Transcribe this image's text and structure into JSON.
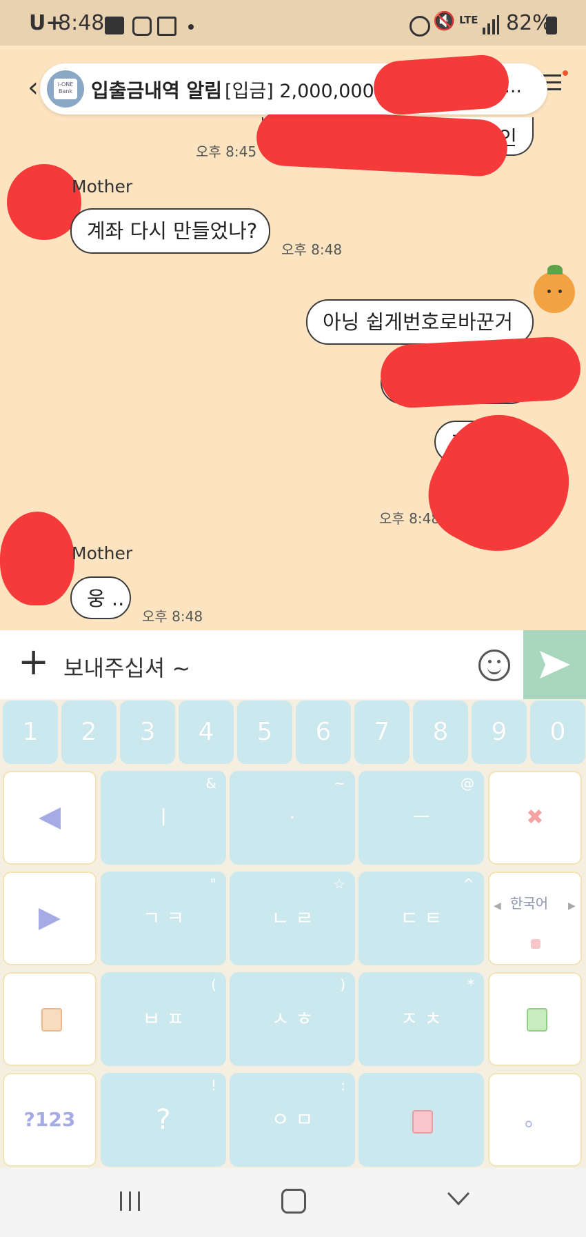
{
  "status_bar": {
    "carrier": "U+",
    "time": "8:48",
    "lte": "LTE",
    "battery": "82%"
  },
  "notification": {
    "bank_logo": "i-ONE Bank",
    "title": "입출금내역 알림",
    "text": "[입금] 2,000,000원",
    "ellipsis": "-*..."
  },
  "chat": {
    "messages": [
      {
        "time": "오후 8:45"
      },
      {
        "sender": "Mother",
        "text": "계좌 다시 만들었나?",
        "time": "오후 8:48"
      },
      {
        "text": "아닝 쉽게번호로바꾼거"
      },
      {
        "text": "기억"
      },
      {
        "time": "오후 8:48"
      },
      {
        "sender": "Mother",
        "text": "웅 ..",
        "time": "오후 8:48"
      }
    ],
    "partial_text": "확인"
  },
  "input": {
    "value": "보내주십셔 ~",
    "plus_label": "+"
  },
  "keyboard": {
    "numbers": [
      "1",
      "2",
      "3",
      "4",
      "5",
      "6",
      "7",
      "8",
      "9",
      "0"
    ],
    "rows": [
      {
        "left": "◀",
        "keys": [
          {
            "main": "ㅣ",
            "sub": "&"
          },
          {
            "main": "·",
            "sub": "~"
          },
          {
            "main": "ㅡ",
            "sub": "@"
          }
        ],
        "right": "✖"
      },
      {
        "left": "▶",
        "keys": [
          {
            "main": "ㄱ ㅋ",
            "sub": "\""
          },
          {
            "main": "ㄴ ㄹ",
            "sub": "☆"
          },
          {
            "main": "ㄷ ㅌ",
            "sub": "^"
          }
        ],
        "right": "한국어"
      },
      {
        "left": "milk",
        "keys": [
          {
            "main": "ㅂ ㅍ",
            "sub": "("
          },
          {
            "main": "ㅅ ㅎ",
            "sub": ")"
          },
          {
            "main": "ㅈ ㅊ",
            "sub": "*"
          }
        ],
        "right": "milk"
      },
      {
        "left": "?123",
        "keys": [
          {
            "main": "?",
            "sub": "!"
          },
          {
            "main": "ㅇ ㅁ",
            "sub": ":"
          },
          {
            "main": "milk",
            "sub": ""
          }
        ],
        "right": "。"
      }
    ]
  },
  "colors": {
    "chat_bg": "#fde4c1",
    "key_bg": "#cce8ef",
    "send_bg": "#a9d7bd",
    "redaction": "#f53a3a"
  }
}
